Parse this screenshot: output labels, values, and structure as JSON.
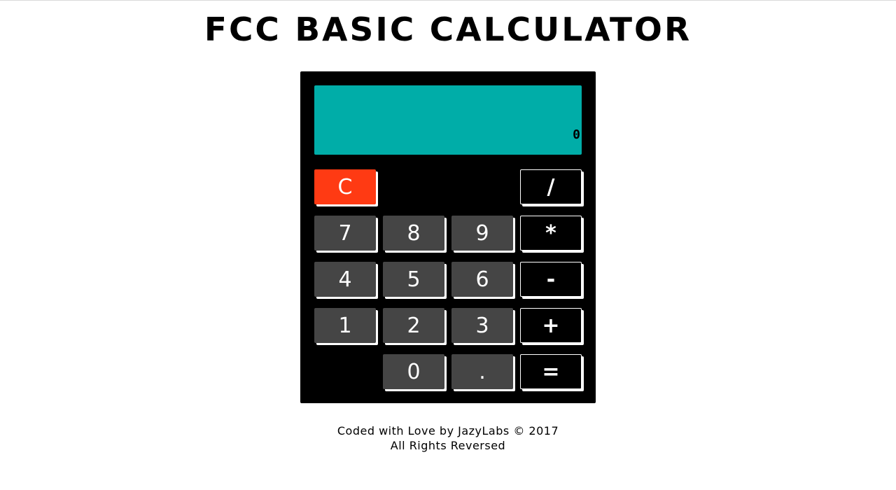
{
  "header": {
    "title": "FCC BASIC CALCULATOR"
  },
  "calculator": {
    "display_value": "0",
    "keys": {
      "clear": "C",
      "divide": "/",
      "seven": "7",
      "eight": "8",
      "nine": "9",
      "multiply": "*",
      "four": "4",
      "five": "5",
      "six": "6",
      "subtract": "-",
      "one": "1",
      "two": "2",
      "three": "3",
      "add": "+",
      "zero": "0",
      "decimal": ".",
      "equals": "="
    }
  },
  "footer": {
    "line1": "Coded with Love by JazyLabs © 2017",
    "line2": "All Rights Reversed"
  },
  "colors": {
    "display": "#00ada8",
    "clear_key": "#ff3a13",
    "number_key": "#454545",
    "operator_key": "#000000"
  }
}
